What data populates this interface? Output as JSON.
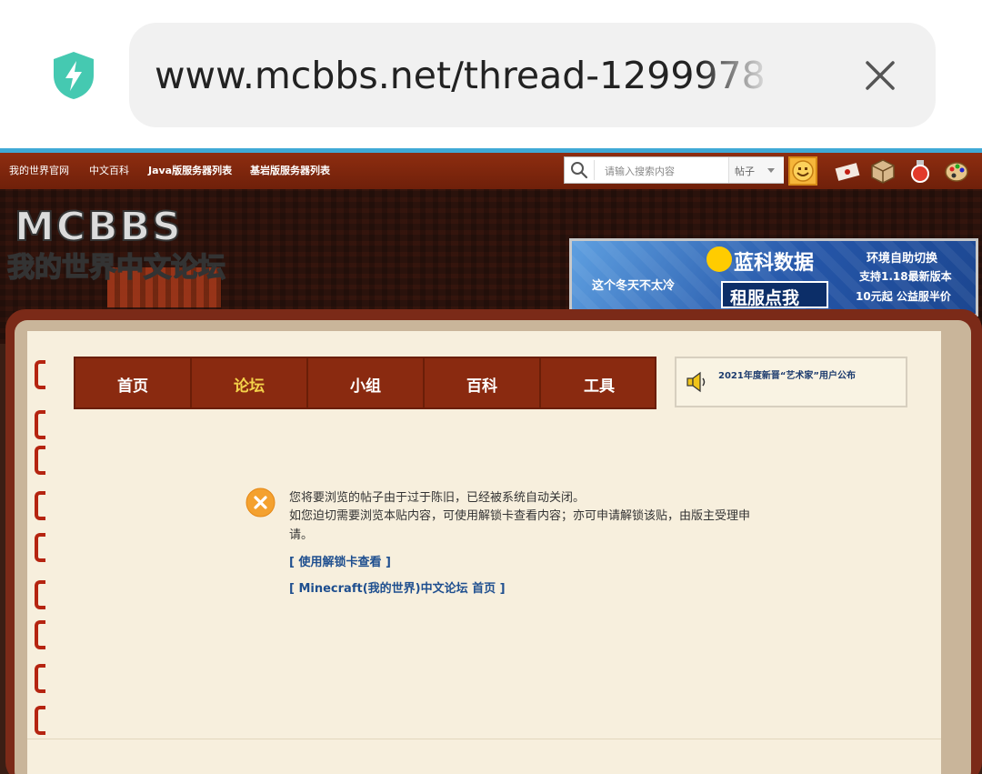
{
  "browser": {
    "url": "www.mcbbs.net/thread-1299978",
    "security_icon": "shield-bolt-icon",
    "close_icon": "close-icon",
    "progress_color": "#3fa9d6"
  },
  "topnav": {
    "links": [
      "我的世界官网",
      "中文百科",
      "Java版服务器列表",
      "基岩版服务器列表"
    ],
    "search_placeholder": "请输入搜索内容",
    "search_scope": "帖子"
  },
  "header": {
    "logo_top": "MCBBS",
    "logo_bottom": "我的世界中文论坛"
  },
  "ad": {
    "slogan": "这个冬天不太冷",
    "brand": "蓝科数据",
    "cta": "租服点我",
    "line1": "环境自助切换",
    "line2": "支持1.18最新版本",
    "line3": "10元起 公益服半价"
  },
  "tabs": [
    {
      "label": "首页",
      "active": false
    },
    {
      "label": "论坛",
      "active": true
    },
    {
      "label": "小组",
      "active": false
    },
    {
      "label": "百科",
      "active": false
    },
    {
      "label": "工具",
      "active": false
    }
  ],
  "notice": {
    "text": "2021年度新晋“艺术家”用户公布"
  },
  "message": {
    "line1": "您将要浏览的帖子由于过于陈旧，已经被系统自动关闭。",
    "line2": "如您迫切需要浏览本贴内容，可使用解锁卡查看内容；亦可申请解锁该贴，由版主受理申请。",
    "link_unlock": "[ 使用解锁卡查看 ]",
    "link_home": "[ Minecraft(我的世界)中文论坛 首页 ]"
  },
  "colors": {
    "nav_red": "#8a2a10",
    "active_tab": "#f4d24a",
    "page_bg": "#f7efdd",
    "link_blue": "#1f4f8f"
  }
}
